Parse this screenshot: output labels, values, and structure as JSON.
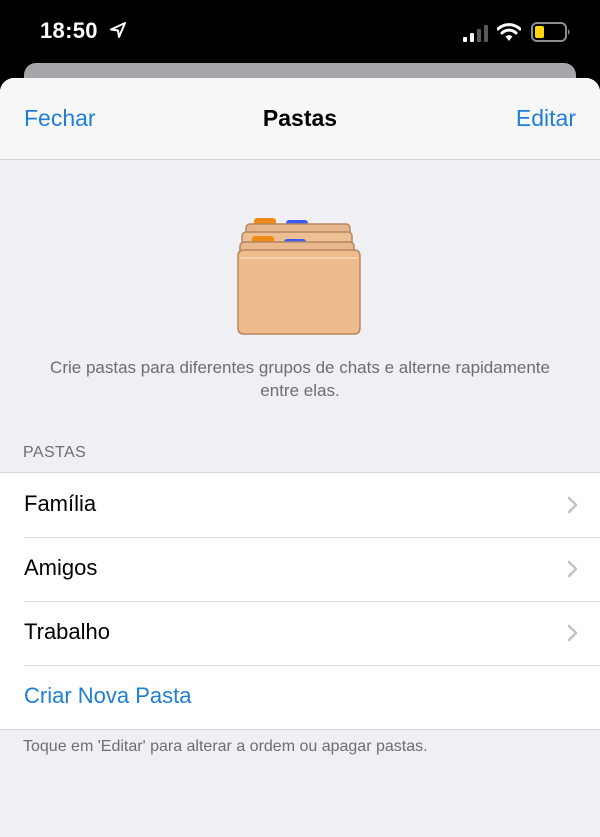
{
  "status_bar": {
    "time": "18:50",
    "icons": [
      "location-arrow-icon",
      "cellular-signal-icon",
      "wifi-icon",
      "battery-low-icon"
    ],
    "battery_color": "#ffd60a"
  },
  "nav": {
    "left_label": "Fechar",
    "title": "Pastas",
    "right_label": "Editar"
  },
  "intro": {
    "illustration": "folders-illustration",
    "text": "Crie pastas para diferentes grupos de chats e alterne rapidamente entre elas."
  },
  "folders_section": {
    "header": "PASTAS",
    "items": [
      {
        "label": "Família"
      },
      {
        "label": "Amigos"
      },
      {
        "label": "Trabalho"
      }
    ],
    "create_label": "Criar Nova Pasta"
  },
  "footer": {
    "hint": "Toque em 'Editar' para alterar a ordem ou apagar pastas."
  },
  "colors": {
    "accent": "#1f7ed8",
    "background": "#efeff4",
    "secondary_text": "#6d6d72"
  }
}
